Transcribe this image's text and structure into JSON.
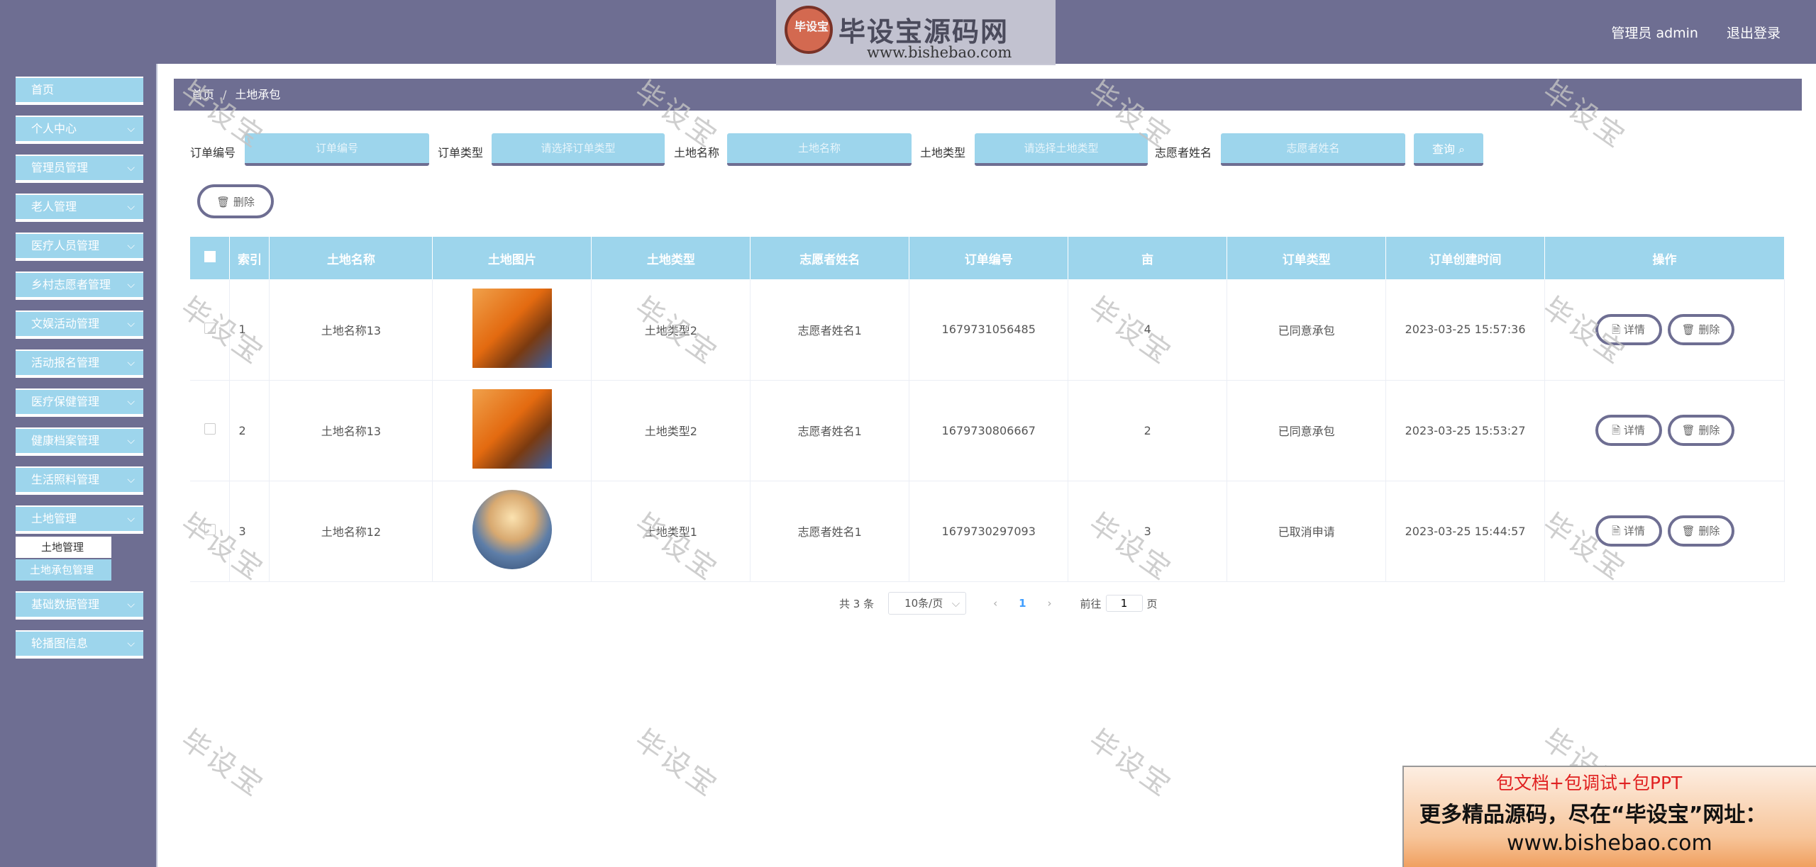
{
  "header": {
    "logo_badge": "毕设宝",
    "logo_title": "毕设宝源码网",
    "logo_url": "www.bishebao.com",
    "user_label": "管理员 admin",
    "logout_label": "退出登录"
  },
  "sidebar": {
    "items": [
      {
        "label": "首页"
      },
      {
        "label": "个人中心"
      },
      {
        "label": "管理员管理"
      },
      {
        "label": "老人管理"
      },
      {
        "label": "医疗人员管理"
      },
      {
        "label": "乡村志愿者管理"
      },
      {
        "label": "文娱活动管理"
      },
      {
        "label": "活动报名管理"
      },
      {
        "label": "医疗保健管理"
      },
      {
        "label": "健康档案管理"
      },
      {
        "label": "生活照料管理"
      },
      {
        "label": "土地管理"
      },
      {
        "label": "基础数据管理"
      },
      {
        "label": "轮播图信息"
      }
    ],
    "submenu": [
      "土地管理",
      "土地承包管理"
    ]
  },
  "breadcrumb": {
    "home": "首页",
    "sep": "/",
    "current": "土地承包"
  },
  "search": {
    "order_no_label": "订单编号",
    "order_no_placeholder": "订单编号",
    "order_type_label": "订单类型",
    "order_type_placeholder": "请选择订单类型",
    "land_name_label": "土地名称",
    "land_name_placeholder": "土地名称",
    "land_type_label": "土地类型",
    "land_type_placeholder": "请选择土地类型",
    "volunteer_label": "志愿者姓名",
    "volunteer_placeholder": "志愿者姓名",
    "query_label": "查询 ⌕"
  },
  "actions": {
    "delete_label": "🗑 删除"
  },
  "table": {
    "headers": [
      "索引",
      "土地名称",
      "土地图片",
      "土地类型",
      "志愿者姓名",
      "订单编号",
      "亩",
      "订单类型",
      "订单创建时间",
      "操作"
    ],
    "detail_label": "详情",
    "delete_label": "删除",
    "rows": [
      {
        "index": "1",
        "land_name": "土地名称13",
        "land_type": "土地类型2",
        "volunteer": "志愿者姓名1",
        "order_no": "1679731056485",
        "mu": "4",
        "order_type": "已同意承包",
        "created": "2023-03-25 15:57:36"
      },
      {
        "index": "2",
        "land_name": "土地名称13",
        "land_type": "土地类型2",
        "volunteer": "志愿者姓名1",
        "order_no": "1679730806667",
        "mu": "2",
        "order_type": "已同意承包",
        "created": "2023-03-25 15:53:27"
      },
      {
        "index": "3",
        "land_name": "土地名称12",
        "land_type": "土地类型1",
        "volunteer": "志愿者姓名1",
        "order_no": "1679730297093",
        "mu": "3",
        "order_type": "已取消申请",
        "created": "2023-03-25 15:44:57"
      }
    ]
  },
  "pagination": {
    "total": "共 3 条",
    "page_size": "10条/页",
    "current": "1",
    "goto_label": "前往",
    "goto_value": "1",
    "page_suffix": "页"
  },
  "watermark": "毕设宝",
  "ad": {
    "line1": "包文档+包调试+包PPT",
    "line2": "更多精品源码，尽在“毕设宝”网址：",
    "line3": "www.bishebao.com"
  }
}
